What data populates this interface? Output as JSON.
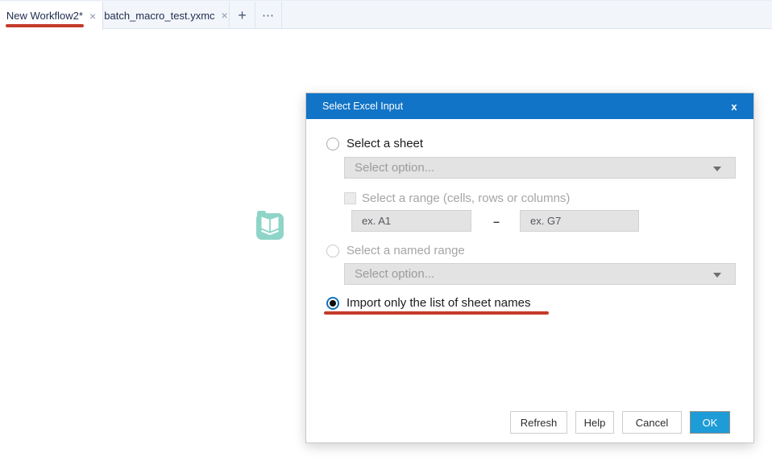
{
  "colors": {
    "header_blue": "#1174c6",
    "ok_button_blue": "#1e9cd7",
    "annotation_red": "#c43a2a",
    "tool_teal": "#8ed5c8",
    "radio_selected_blue": "#1273bb"
  },
  "icons": {
    "close_tab": "×",
    "new_tab": "+",
    "more_tabs": "⋯",
    "dialog_close": "x",
    "range_separator": "–"
  },
  "tab_bar": {
    "tabs": [
      {
        "label": "New Workflow2*"
      },
      {
        "label": "batch_macro_test.yxmc"
      }
    ]
  },
  "dialog": {
    "title": "Select Excel Input",
    "sheet_option": {
      "label": "Select a sheet",
      "dropdown_placeholder": "Select option..."
    },
    "range_option": {
      "label": "Select a range (cells, rows or columns)",
      "from_placeholder": "ex. A1",
      "to_placeholder": "ex. G7"
    },
    "named_range_option": {
      "label": "Select a named range",
      "dropdown_placeholder": "Select option..."
    },
    "sheet_names_option": {
      "label": "Import only the list of sheet names",
      "selected": true
    },
    "buttons": {
      "refresh": "Refresh",
      "help": "Help",
      "cancel": "Cancel",
      "ok": "OK"
    }
  }
}
